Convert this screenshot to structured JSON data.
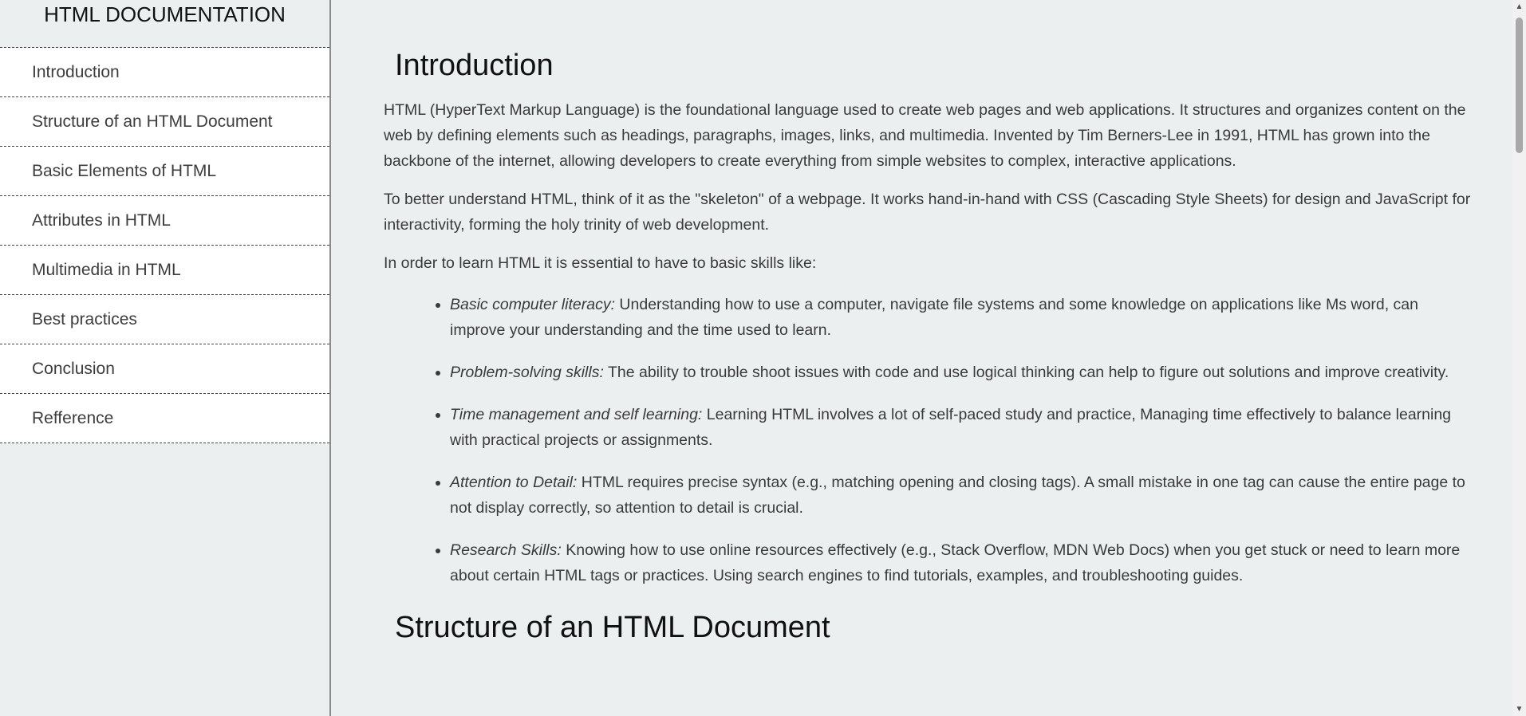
{
  "navbar": {
    "header": "HTML DOCUMENTATION",
    "items": [
      {
        "label": "Introduction"
      },
      {
        "label": "Structure of an HTML Document"
      },
      {
        "label": "Basic Elements of HTML"
      },
      {
        "label": "Attributes in HTML"
      },
      {
        "label": "Multimedia in HTML"
      },
      {
        "label": "Best practices"
      },
      {
        "label": "Conclusion"
      },
      {
        "label": "Refference"
      }
    ]
  },
  "main": {
    "intro": {
      "title": "Introduction",
      "p1": "HTML (HyperText Markup Language) is the foundational language used to create web pages and web applications. It structures and organizes content on the web by defining elements such as headings, paragraphs, images, links, and multimedia. Invented by Tim Berners-Lee in 1991, HTML has grown into the backbone of the internet, allowing developers to create everything from simple websites to complex, interactive applications.",
      "p2": "To better understand HTML, think of it as the \"skeleton\" of a webpage. It works hand-in-hand with CSS (Cascading Style Sheets) for design and JavaScript for interactivity, forming the holy trinity of web development.",
      "p3": "In order to learn HTML it is essential to have to basic skills like:",
      "skills": [
        {
          "term": "Basic computer literacy:",
          "text": " Understanding how to use a computer, navigate file systems and some knowledge on applications like Ms word, can improve your understanding and the time used to learn."
        },
        {
          "term": "Problem-solving skills:",
          "text": " The ability to trouble shoot issues with code and use logical thinking can help to figure out solutions and improve creativity."
        },
        {
          "term": "Time management and self learning:",
          "text": " Learning HTML involves a lot of self-paced study and practice, Managing time effectively to balance learning with practical projects or assignments."
        },
        {
          "term": "Attention to Detail:",
          "text": " HTML requires precise syntax (e.g., matching opening and closing tags). A small mistake in one tag can cause the entire page to not display correctly, so attention to detail is crucial."
        },
        {
          "term": "Research Skills:",
          "text": " Knowing how to use online resources effectively (e.g., Stack Overflow, MDN Web Docs) when you get stuck or need to learn more about certain HTML tags or practices. Using search engines to find tutorials, examples, and troubleshooting guides."
        }
      ]
    },
    "structure": {
      "title": "Structure of an HTML Document"
    }
  },
  "scrollbar": {
    "up_icon": "▲",
    "down_icon": "▼"
  }
}
